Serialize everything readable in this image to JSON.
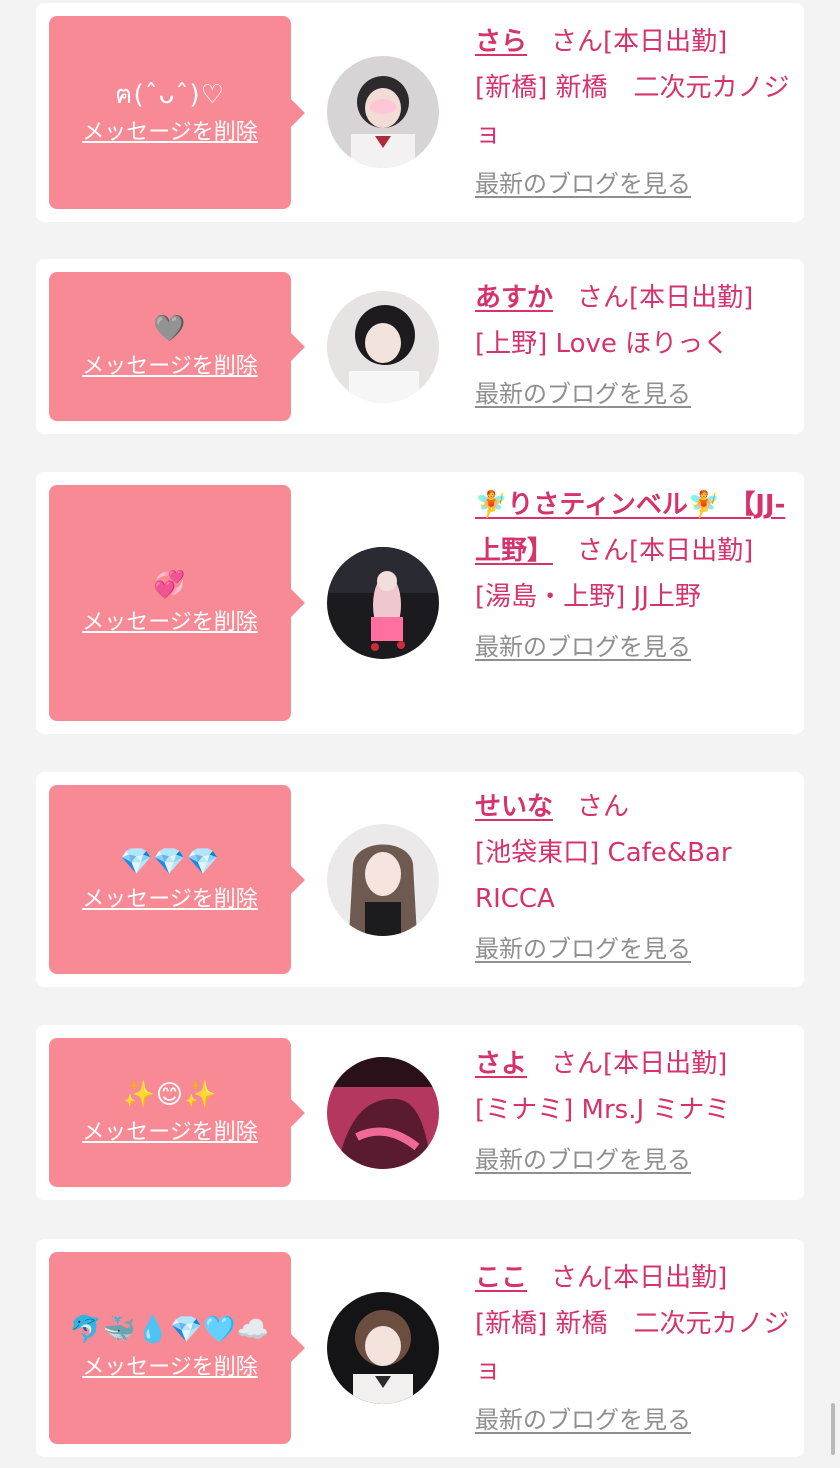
{
  "delete_label": "メッセージを削除",
  "blog_label": "最新のブログを見る",
  "honorific": "さん",
  "accent_color": "#f88a95",
  "name_color": "#d6336c",
  "items": [
    {
      "name": "さら",
      "status": "[本日出勤]",
      "shop": "[新橋] 新橋　二次元カノジョ",
      "message": "ฅ(ˆᴗˆ)♡"
    },
    {
      "name": "あすか",
      "status": "[本日出勤]",
      "shop": "[上野] Love ほりっく",
      "message": "🩶"
    },
    {
      "name": "🧚りさティンベル🧚 【JJ-上野】",
      "status": "[本日出勤]",
      "shop": "[湯島・上野] JJ上野",
      "message": "💞"
    },
    {
      "name": "せいな",
      "status": "",
      "shop": "[池袋東口] Cafe&Bar RICCA",
      "message": "💎💎💎"
    },
    {
      "name": "さよ",
      "status": "[本日出勤]",
      "shop": "[ミナミ] Mrs.J ミナミ",
      "message": "✨😊✨"
    },
    {
      "name": "ここ",
      "status": "[本日出勤]",
      "shop": "[新橋] 新橋　二次元カノジョ",
      "message": "🐬🐳💧💎🩵☁️"
    }
  ]
}
